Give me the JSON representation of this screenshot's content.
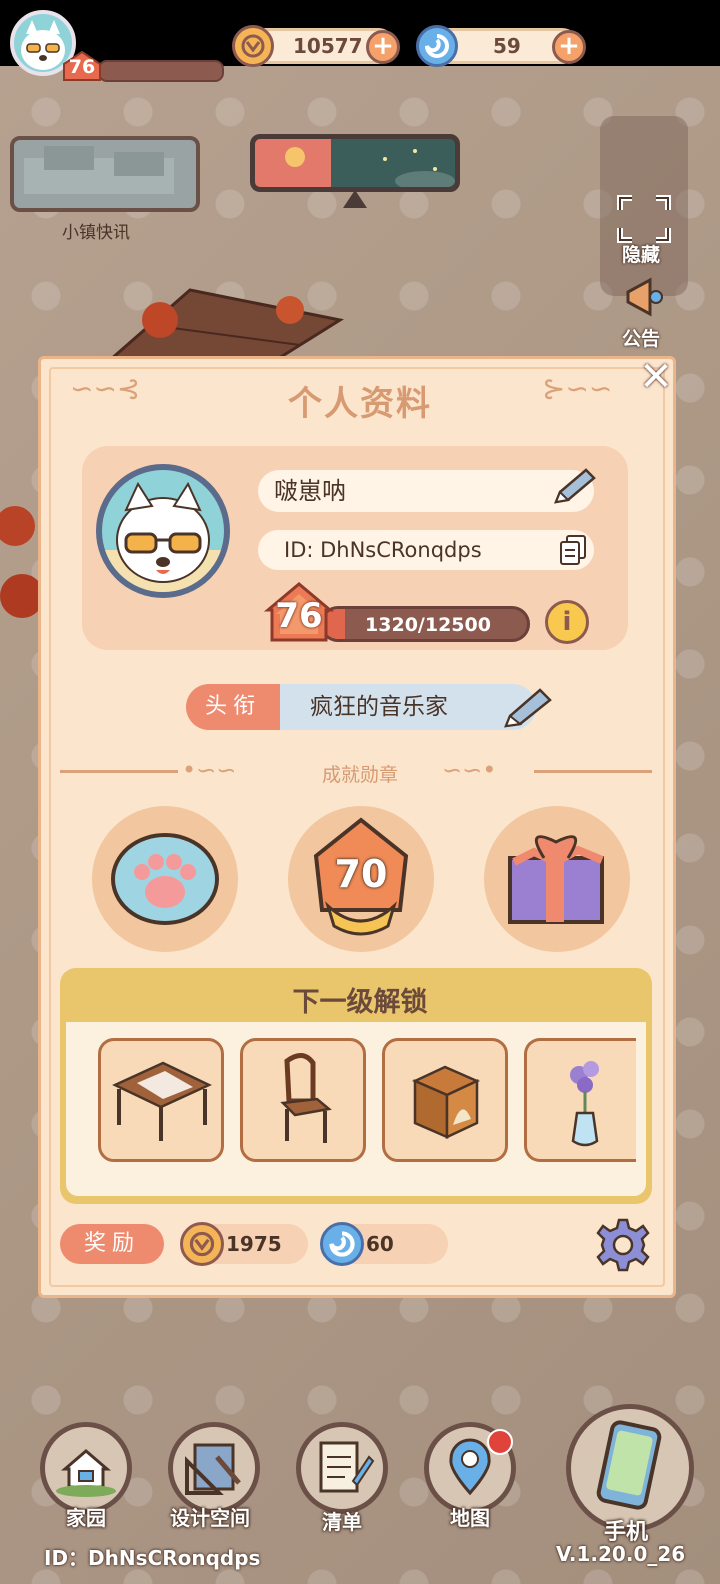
{
  "hud": {
    "player_level": "76",
    "coins": "10577",
    "gems": "59",
    "news_label": "小镇快讯",
    "hide_label": "隐藏",
    "notice_label": "公告"
  },
  "profile": {
    "title": "个人资料",
    "name": "啵崽呐",
    "id": "ID: DhNsCRonqdps",
    "level": "76",
    "xp_text": "1320/12500",
    "xp_fraction": 0.1056,
    "title_tag": "头衔",
    "title_value": "疯狂的音乐家",
    "achievements_label": "成就勋章",
    "badges": [
      {
        "name": "paw-badge",
        "text": ""
      },
      {
        "name": "level-70-badge",
        "text": "70"
      },
      {
        "name": "gift-badge",
        "text": ""
      }
    ],
    "unlock_title": "下一级解锁",
    "unlock_items": [
      "table-icon",
      "chair-icon",
      "cabinet-icon",
      "vase-icon"
    ],
    "reward_tag": "奖励",
    "reward_coins": "1975",
    "reward_gems": "60"
  },
  "nav": {
    "home": "家园",
    "design": "设计空间",
    "list": "清单",
    "map": "地图",
    "phone": "手机"
  },
  "footer": {
    "id": "ID：DhNsCRonqdps",
    "version": "V.1.20.0_26"
  },
  "colors": {
    "panel_bg": "#fbe6cd",
    "accent": "#ee8a6e",
    "title_text": "#d79a72"
  }
}
